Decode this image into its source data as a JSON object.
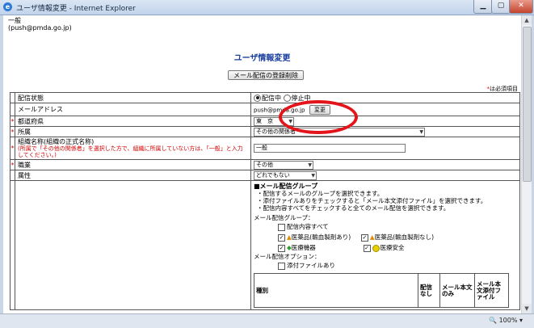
{
  "window": {
    "title": "ユーザ情報変更 - Internet Explorer"
  },
  "account": {
    "line1": "一般",
    "line2": "(push@pmda.go.jp)"
  },
  "page": {
    "title": "ユーザ情報変更",
    "delete_button": "メール配信の登録削除",
    "required_note": "は必須項目",
    "required_mark": "*"
  },
  "rows": {
    "status": {
      "label": "配信状態",
      "opt_on": "配信中",
      "opt_stop": "停止中"
    },
    "email": {
      "label": "メールアドレス",
      "value": "push@pmda.go.jp",
      "change_button": "変更"
    },
    "prefecture": {
      "label": "都道府県",
      "value": "東　京"
    },
    "affiliation": {
      "label": "所属",
      "value": "その他の関係者"
    },
    "org": {
      "label": "組織名称(組織の正式名称)",
      "note": "(所属で「その他の関係者」を選択した方で、組織に所属していない方は、「一般」と入力してください。)",
      "value": "一般"
    },
    "occupation": {
      "label": "職業",
      "value": "その他"
    },
    "attribute": {
      "label": "属性",
      "value": "どれでもない"
    }
  },
  "mail_group": {
    "heading": "■メール配信グループ",
    "notes": [
      "・配信するメールのグループを選択できます。",
      "・添付ファイルありをチェックすると「メール本文添付ファイル」を選択できます。",
      "・配信内容すべてをチェックすると全てのメール配信を選択できます。"
    ],
    "group_label": "メール配信グループ：",
    "all_label": "配信内容すべて",
    "items": [
      {
        "label": "医薬品(輸血製剤あり)",
        "checked": true
      },
      {
        "label": "医薬品(輸血製剤なし)",
        "checked": true
      },
      {
        "label": "医療機器",
        "checked": true
      },
      {
        "label": "医療安全",
        "checked": true
      }
    ],
    "option_label": "メール配信オプション：",
    "attach_label": "添付ファイルあり",
    "table_headers": [
      "種別",
      "配信なし",
      "メール本文のみ",
      "メール本文添付ファイル"
    ]
  },
  "status": {
    "zoom": "100%"
  }
}
